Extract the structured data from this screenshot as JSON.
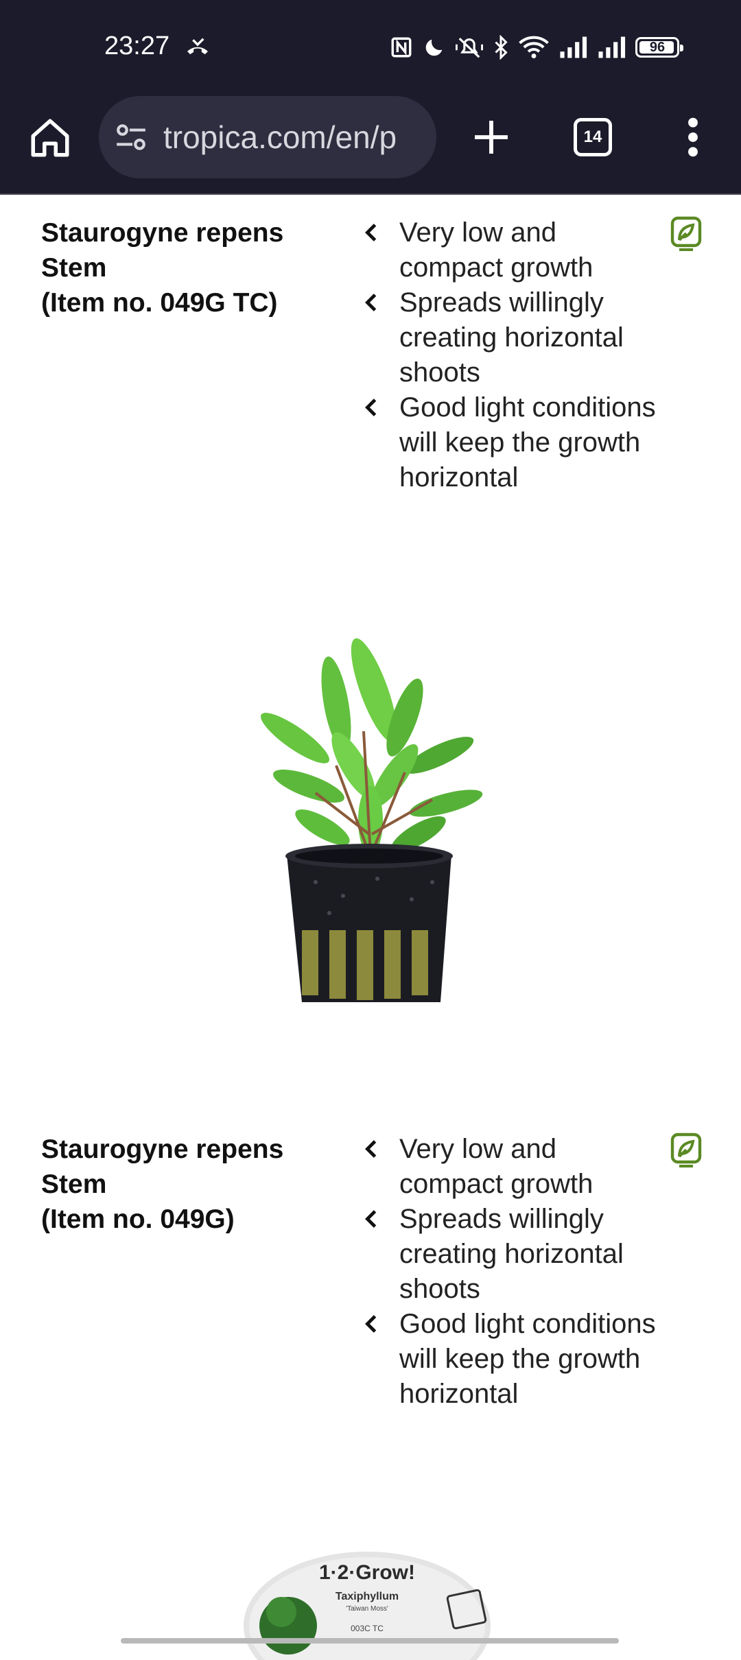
{
  "status_bar": {
    "time": "23:27",
    "battery": "96",
    "battery_level": 0.96,
    "icons": [
      "missed-call-icon",
      "nfc-icon",
      "moon-icon",
      "mute-vibrate-icon",
      "bluetooth-icon",
      "wifi-icon",
      "signal-icon",
      "signal-icon"
    ]
  },
  "browser": {
    "url": "tropica.com/en/p",
    "tab_count": "14",
    "icons": [
      "home-icon",
      "site-settings-icon",
      "plus-icon",
      "tab-switcher-icon",
      "more-vert-icon"
    ]
  },
  "products": [
    {
      "title_lines": [
        "Staurogyne repens",
        "Stem",
        "(Item no. 049G TC)"
      ],
      "features": [
        "Very low and compact growth",
        "Spreads willingly creating horizontal shoots",
        "Good light conditions will keep the growth horizontal"
      ],
      "badge_icon": "eco-leaf-icon"
    },
    {
      "title_lines": [
        "Staurogyne repens",
        "Stem",
        "(Item no. 049G)"
      ],
      "features": [
        "Very low and compact growth",
        "Spreads willingly creating horizontal shoots",
        "Good light conditions will keep the growth horizontal"
      ],
      "badge_icon": "eco-leaf-icon"
    }
  ],
  "next_product_label": {
    "brand": "1·2·Grow!",
    "name": "Taxiphyllum",
    "subname": "'Taiwan Moss'",
    "code": "003C TC"
  },
  "colors": {
    "chrome_bg": "#1c1b2b",
    "url_bar_bg": "#2f2e40",
    "badge_green": "#5b8a24"
  }
}
